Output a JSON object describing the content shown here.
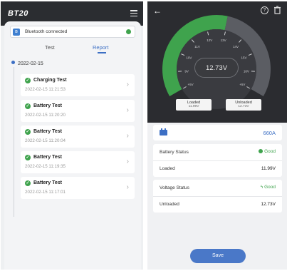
{
  "left": {
    "logo": "BT20",
    "bluetooth_status": "Bluetooth connected",
    "tabs": [
      "Test",
      "Report"
    ],
    "date": "2022-02-15",
    "reports": [
      {
        "title": "Charging Test",
        "time": "2022-02-15 11:21:53"
      },
      {
        "title": "Battery Test",
        "time": "2022-02-15 11:20:20"
      },
      {
        "title": "Battery Test",
        "time": "2022-02-15 11:20:04"
      },
      {
        "title": "Battery Test",
        "time": "2022-02-15 11:19:35"
      },
      {
        "title": "Battery Test",
        "time": "2022-02-15 11:17:01"
      }
    ]
  },
  "right": {
    "gauge": {
      "reading": "12.73V",
      "ticks": [
        "+5V",
        "9V",
        "10V",
        "11V",
        "12V",
        "13V",
        "14V",
        "15V",
        "16V",
        "+5V"
      ],
      "green_color": "#3fa34d",
      "dark_color": "#3a3b40"
    },
    "loaded_pill": {
      "label": "Loaded",
      "value": "11.99V"
    },
    "unloaded_pill": {
      "label": "Unloaded",
      "value": "12.73V"
    },
    "cca": "660A",
    "battery_status": {
      "label": "Battery Status",
      "value": "Good"
    },
    "loaded_row": {
      "label": "Loaded",
      "value": "11.99V"
    },
    "voltage_status": {
      "label": "Voltage Status",
      "value": "Good"
    },
    "unloaded_row": {
      "label": "Unloaded",
      "value": "12.73V"
    },
    "save_label": "Save"
  }
}
